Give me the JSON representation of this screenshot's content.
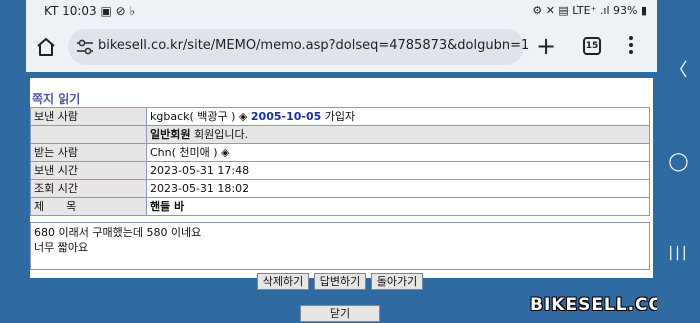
{
  "status_bar": {
    "left_text": "KT 10:03 ▣ ⊘ ♭",
    "right_text": "⚙ ✕ ▤ LTE⁺ .ıl 93% ▮"
  },
  "browser": {
    "url": "bikesell.co.kr/site/MEMO/memo.asp?dolseq=4785873&dolgubn=1",
    "tab_count": "15",
    "new_tab_symbol": "+",
    "home_icon": "home-icon",
    "menu_icon": "more-vert-icon"
  },
  "page": {
    "title": "쪽지 읽기",
    "rows": [
      {
        "label": "보낸 사람",
        "value_prefix": "kgback( 백광구 ) ◈ ",
        "value_date": "2005-10-05",
        "value_suffix": " 가입자"
      },
      {
        "label": "",
        "value_bold": "일반회원",
        "value_suffix": " 회원입니다."
      },
      {
        "label": "받는 사람",
        "value": "Chn( 천미애 ) ◈"
      },
      {
        "label": "보낸 시간",
        "value": "2023-05-31 17:48"
      },
      {
        "label": "조회 시간",
        "value": "2023-05-31 18:02"
      },
      {
        "label": "제　　목",
        "value_bold": "핸들 바"
      }
    ],
    "body_line1": "680 이래서 구매했는데 580 이네요",
    "body_line2": "너무 짧아요",
    "buttons": {
      "delete": "삭제하기",
      "reply": "답변하기",
      "back": "돌아가기",
      "close": "닫기"
    }
  },
  "watermark": "BIKESELL.CO.KR",
  "nav": {
    "back_symbol": "〈",
    "home_symbol": "◯",
    "recents_symbol": "|||"
  },
  "colors": {
    "background_blue": "#2f6aa3",
    "title_purple": "#4a5aa8",
    "date_link_blue": "#1b2fa8",
    "label_gray": "#e6e6e6"
  }
}
